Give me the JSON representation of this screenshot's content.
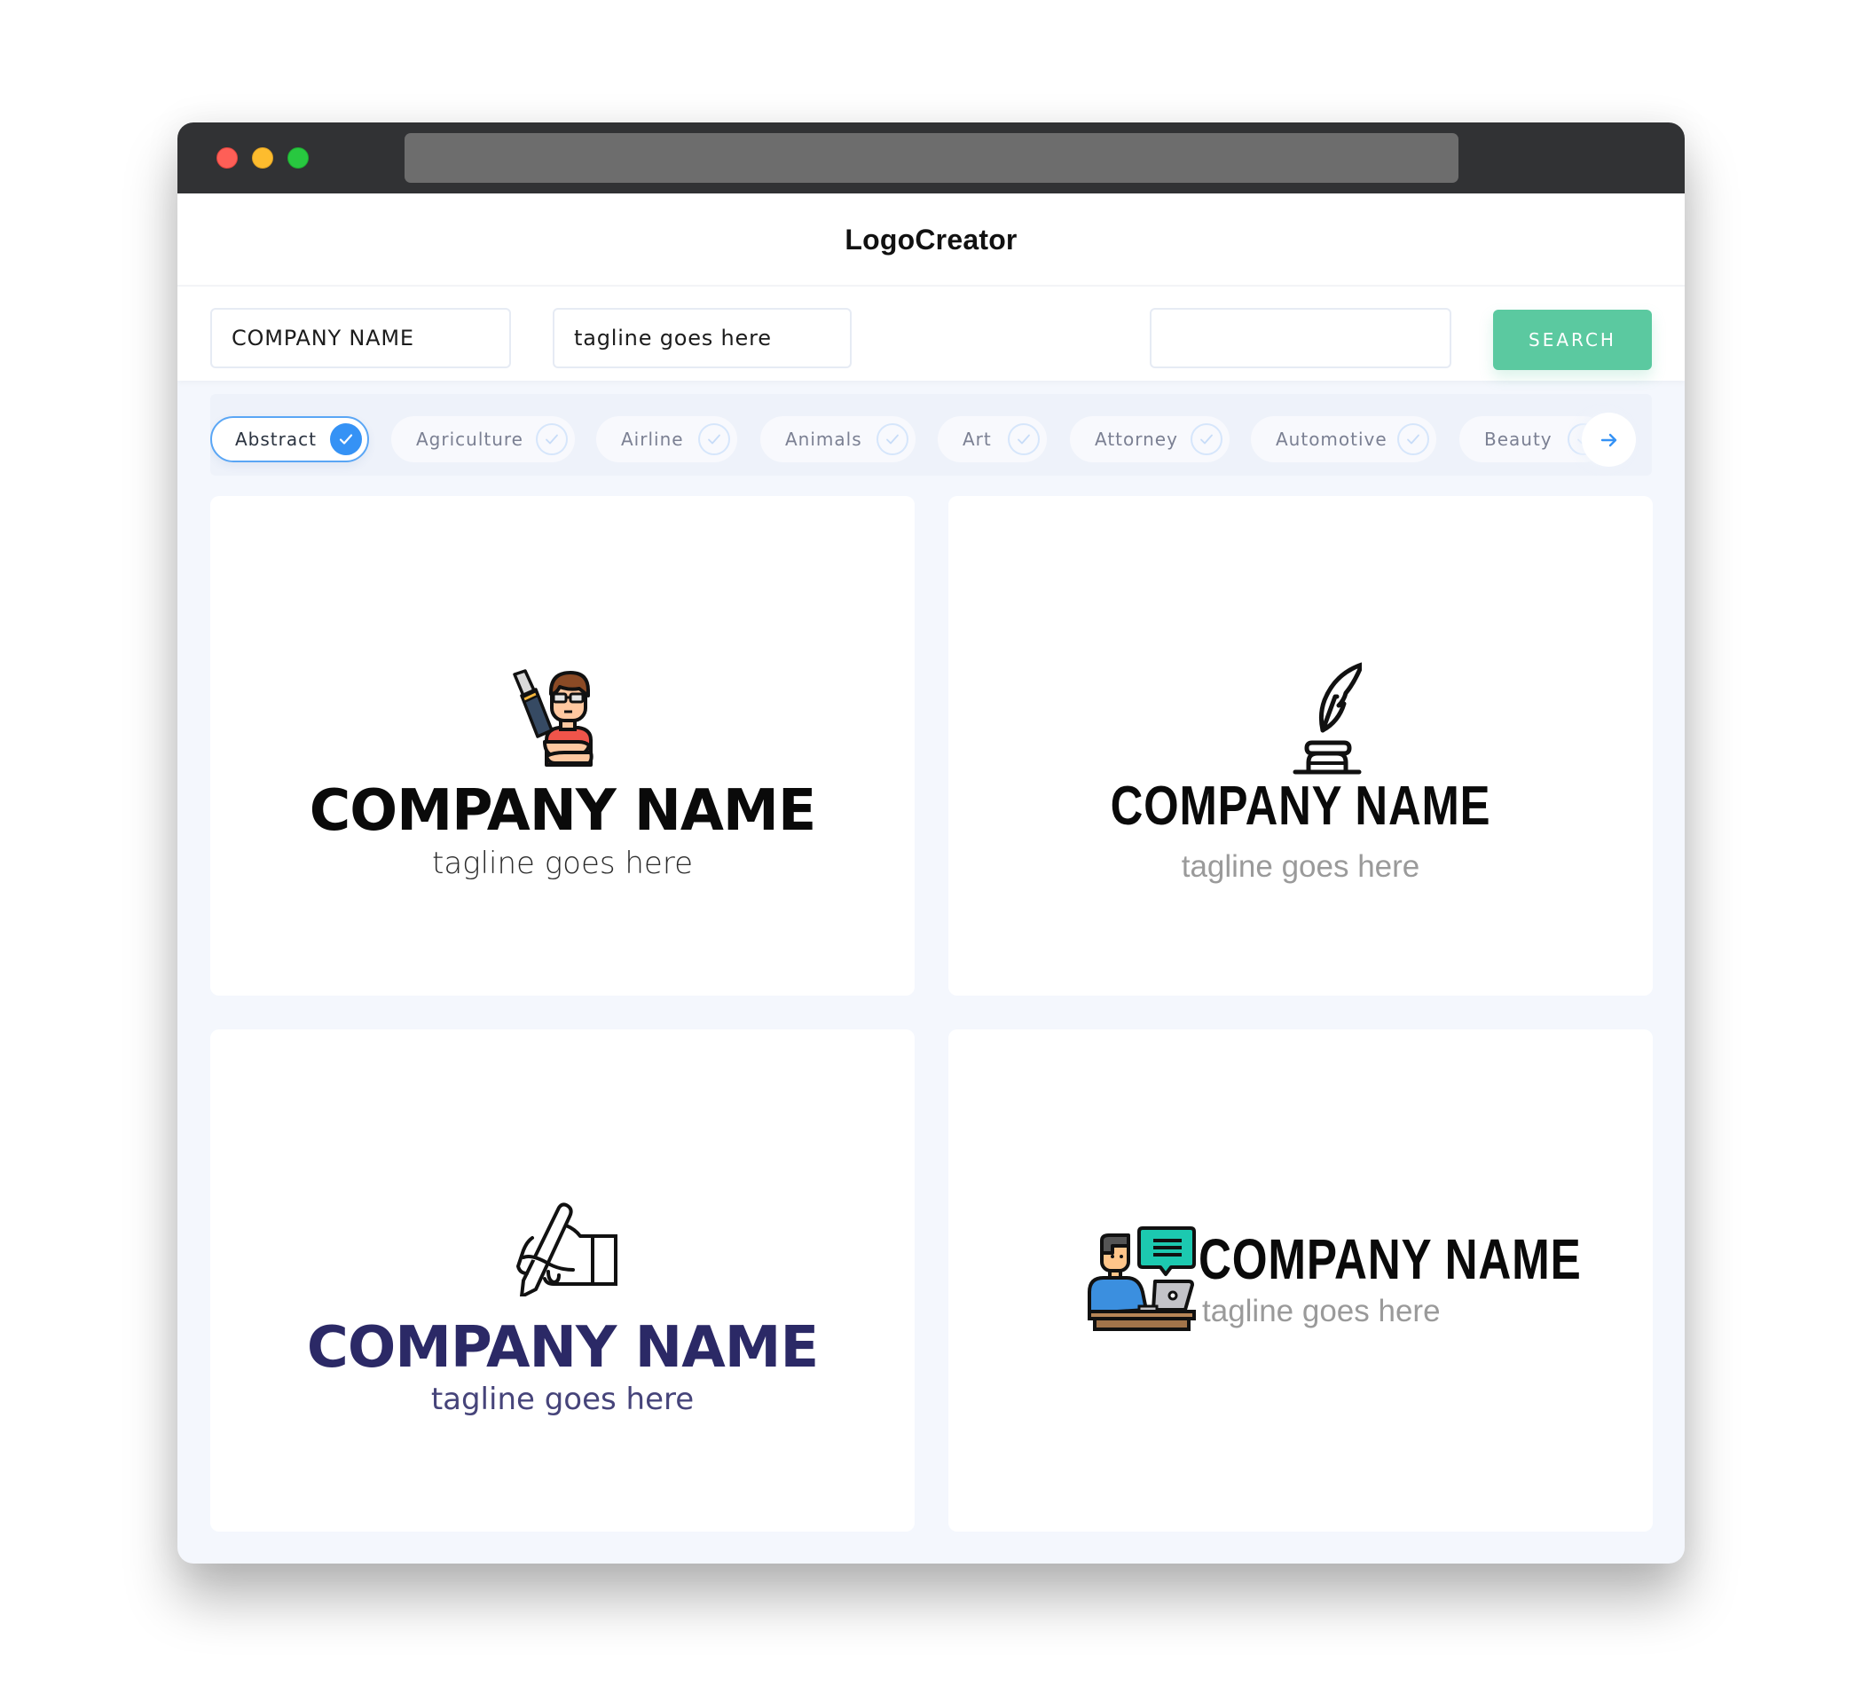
{
  "window": {
    "controls": [
      "close",
      "minimize",
      "maximize"
    ],
    "address_bar": ""
  },
  "header": {
    "title": "LogoCreator"
  },
  "toolbar": {
    "company_name_value": "COMPANY NAME",
    "tagline_value": "tagline goes here",
    "search_value": "",
    "search_label": "SEARCH"
  },
  "categories": {
    "items": [
      {
        "label": "Abstract",
        "selected": true
      },
      {
        "label": "Agriculture",
        "selected": false
      },
      {
        "label": "Airline",
        "selected": false
      },
      {
        "label": "Animals",
        "selected": false
      },
      {
        "label": "Art",
        "selected": false
      },
      {
        "label": "Attorney",
        "selected": false
      },
      {
        "label": "Automotive",
        "selected": false
      },
      {
        "label": "Beauty",
        "selected": false
      }
    ],
    "next_icon": "arrow-right-icon"
  },
  "colors": {
    "accent": "#3592f5",
    "search_button": "#5bc9a0",
    "navy_text": "#2b2966",
    "title_bar": "#313234"
  },
  "logos": [
    {
      "icon": "writer-with-fountain-pen-icon",
      "company": "COMPANY NAME",
      "tagline": "tagline goes here"
    },
    {
      "icon": "quill-inkwell-icon",
      "company": "COMPANY NAME",
      "tagline": "tagline goes here"
    },
    {
      "icon": "hand-writing-pen-icon",
      "company": "COMPANY NAME",
      "tagline": "tagline goes here"
    },
    {
      "icon": "person-at-laptop-chat-icon",
      "company": "COMPANY NAME",
      "tagline": "tagline goes here"
    }
  ]
}
